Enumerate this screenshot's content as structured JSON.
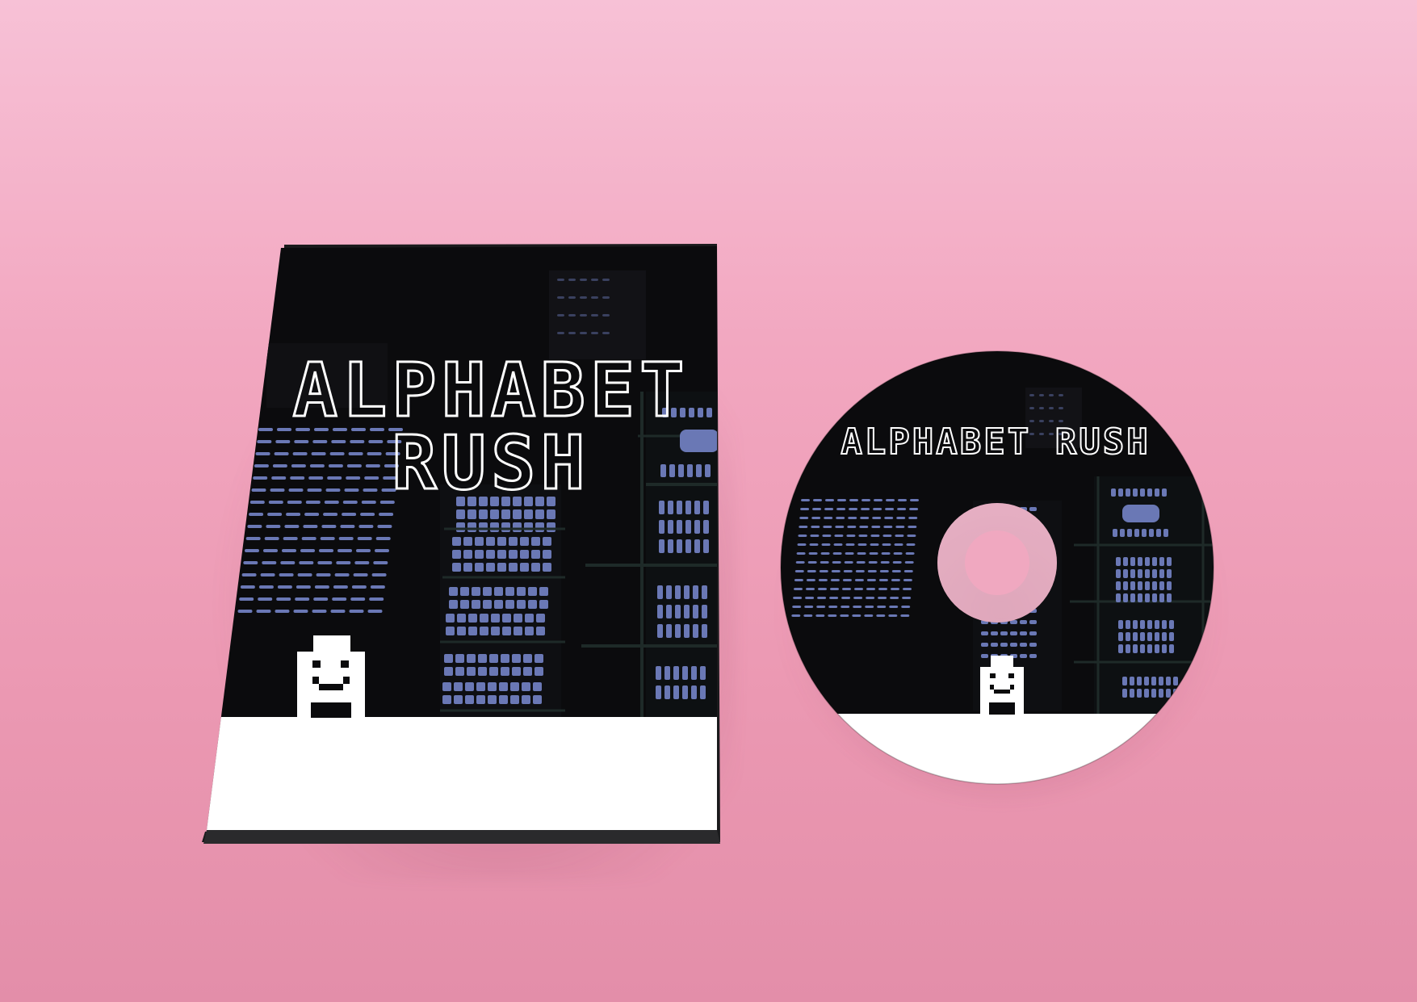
{
  "case": {
    "title_line1": "ALPHABET",
    "title_line2": "RUSH"
  },
  "disc": {
    "title": "ALPHABET RUSH"
  },
  "colors": {
    "background_top": "#f7c1d6",
    "background_bottom": "#e38ea9",
    "cover_dark": "#0b0b0d",
    "window_blue": "#6a78b5",
    "building_outline": "#1e2a28",
    "ground_white": "#ffffff",
    "title_outline": "#ffffff"
  }
}
